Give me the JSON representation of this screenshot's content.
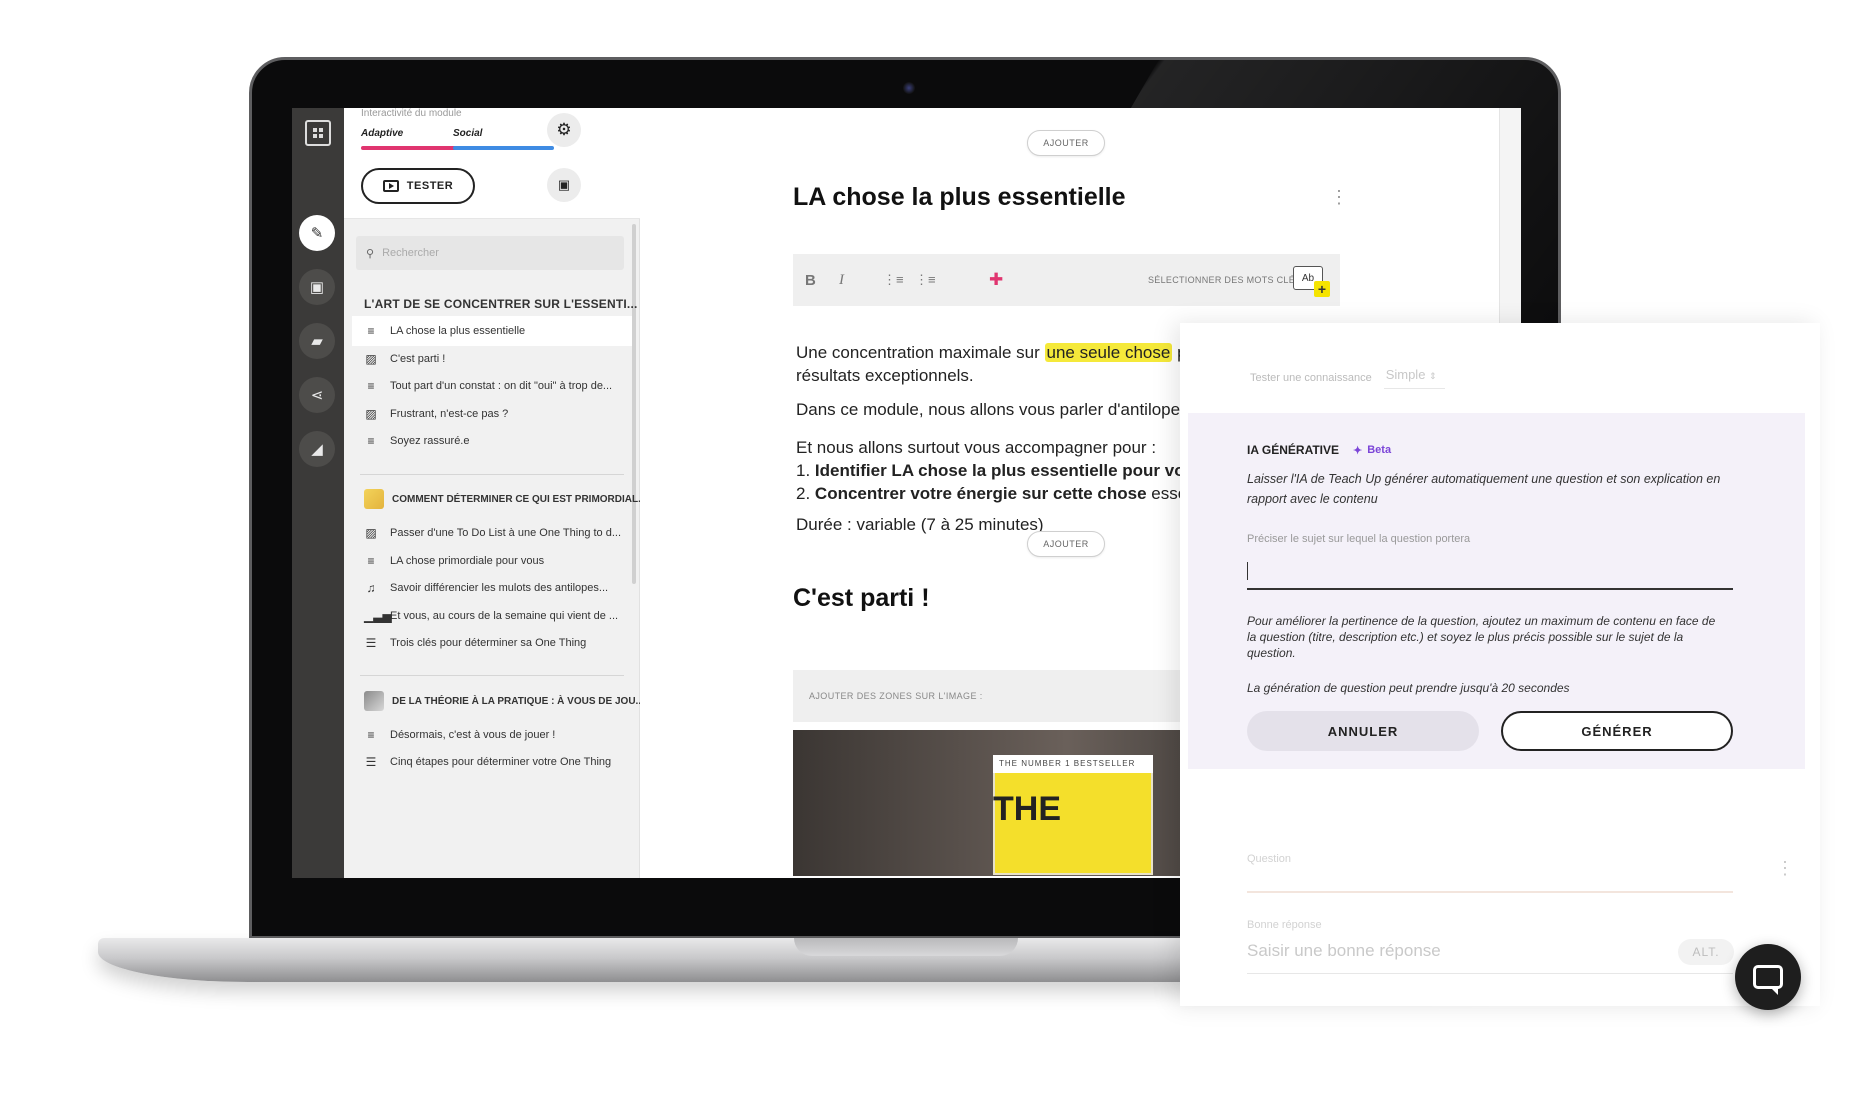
{
  "sidebar": {
    "interactivity_label": "Interactivité du module",
    "modes": [
      "Adaptive",
      "Social"
    ],
    "mode_colors": [
      "#e0356f",
      "#3e8be3"
    ],
    "tester_label": "TESTER",
    "search_placeholder": "Rechercher",
    "section1": {
      "title": "L'ART DE SE CONCENTRER SUR L'ESSENTI...",
      "items": [
        {
          "icon": "text-icon",
          "label": "LA chose la plus essentielle"
        },
        {
          "icon": "image-icon",
          "label": "C'est parti !"
        },
        {
          "icon": "text-icon",
          "label": "Tout part d'un constat : on dit \"oui\" à trop de..."
        },
        {
          "icon": "image-icon",
          "label": "Frustrant, n'est-ce pas ?"
        },
        {
          "icon": "text-icon",
          "label": "Soyez rassuré.e"
        }
      ]
    },
    "section2": {
      "title": "COMMENT DÉTERMINER CE QUI EST PRIMORDIAL...",
      "items": [
        {
          "icon": "image-icon",
          "label": "Passer d'une To Do List à une One Thing to d..."
        },
        {
          "icon": "text-icon",
          "label": "LA chose primordiale pour vous"
        },
        {
          "icon": "music-icon",
          "label": "Savoir différencier les mulots des antilopes..."
        },
        {
          "icon": "poll-icon",
          "label": "Et vous, au cours de la semaine qui vient de ..."
        },
        {
          "icon": "list-icon",
          "label": "Trois clés pour déterminer sa One Thing"
        }
      ]
    },
    "section3": {
      "title": "DE LA THÉORIE À LA PRATIQUE : À VOUS DE JOU...",
      "items": [
        {
          "icon": "text-icon",
          "label": "Désormais, c'est à vous de jouer !"
        },
        {
          "icon": "list-icon",
          "label": "Cinq étapes pour déterminer votre One Thing"
        }
      ]
    }
  },
  "content": {
    "add_label": "AJOUTER",
    "block1_title": "LA chose la plus essentielle",
    "toolbar": {
      "bold": "B",
      "italic": "I",
      "keywords": "SÉLECTIONNER DES MOTS CLÉS",
      "ab": "Ab"
    },
    "para1_a": "Une concentration maximale sur",
    "para1_hl": "une seule chose",
    "para1_b": "peut",
    "para1_line2": "résultats exceptionnels.",
    "para2": "Dans ce module, nous allons vous parler d'antilopes. S",
    "para3": "Et nous allons surtout vous accompagner pour :",
    "list1_num": "1.",
    "list1_bold": "Identifier LA chose la plus essentielle pour vous",
    "list2_num": "2.",
    "list2_bold": "Concentrer votre énergie sur cette chose",
    "list2_rest": "essentielle",
    "duration": "Durée : variable (7 à 25 minutes)",
    "block2_title": "C'est parti !",
    "image_zones": "AJOUTER DES ZONES SUR L'IMAGE :",
    "book_text": "THE NUMBER 1 BESTSELLER"
  },
  "panel": {
    "test_label": "Tester une connaissance",
    "test_value": "Simple",
    "ia_title": "IA GÉNÉRATIVE",
    "beta": "Beta",
    "ia_desc": "Laisser l'IA de Teach Up générer automatiquement une question et son explication en rapport avec le contenu",
    "field_label": "Préciser le sujet sur lequel la question portera",
    "hint": "Pour améliorer la pertinence de la question, ajoutez un maximum de contenu en face de la question (titre, description etc.) et soyez le plus précis possible sur le sujet de la question.",
    "time_note": "La génération de question peut prendre jusqu'à 20 secondes",
    "cancel": "ANNULER",
    "generate": "GÉNÉRER",
    "question_label": "Question",
    "answer_label": "Bonne réponse",
    "answer_placeholder": "Saisir une bonne réponse",
    "alt": "ALT."
  },
  "colors": {
    "accent_purple": "#7b45d8",
    "highlight": "#f5e93a",
    "panel_bg": "#f4f1f9"
  }
}
